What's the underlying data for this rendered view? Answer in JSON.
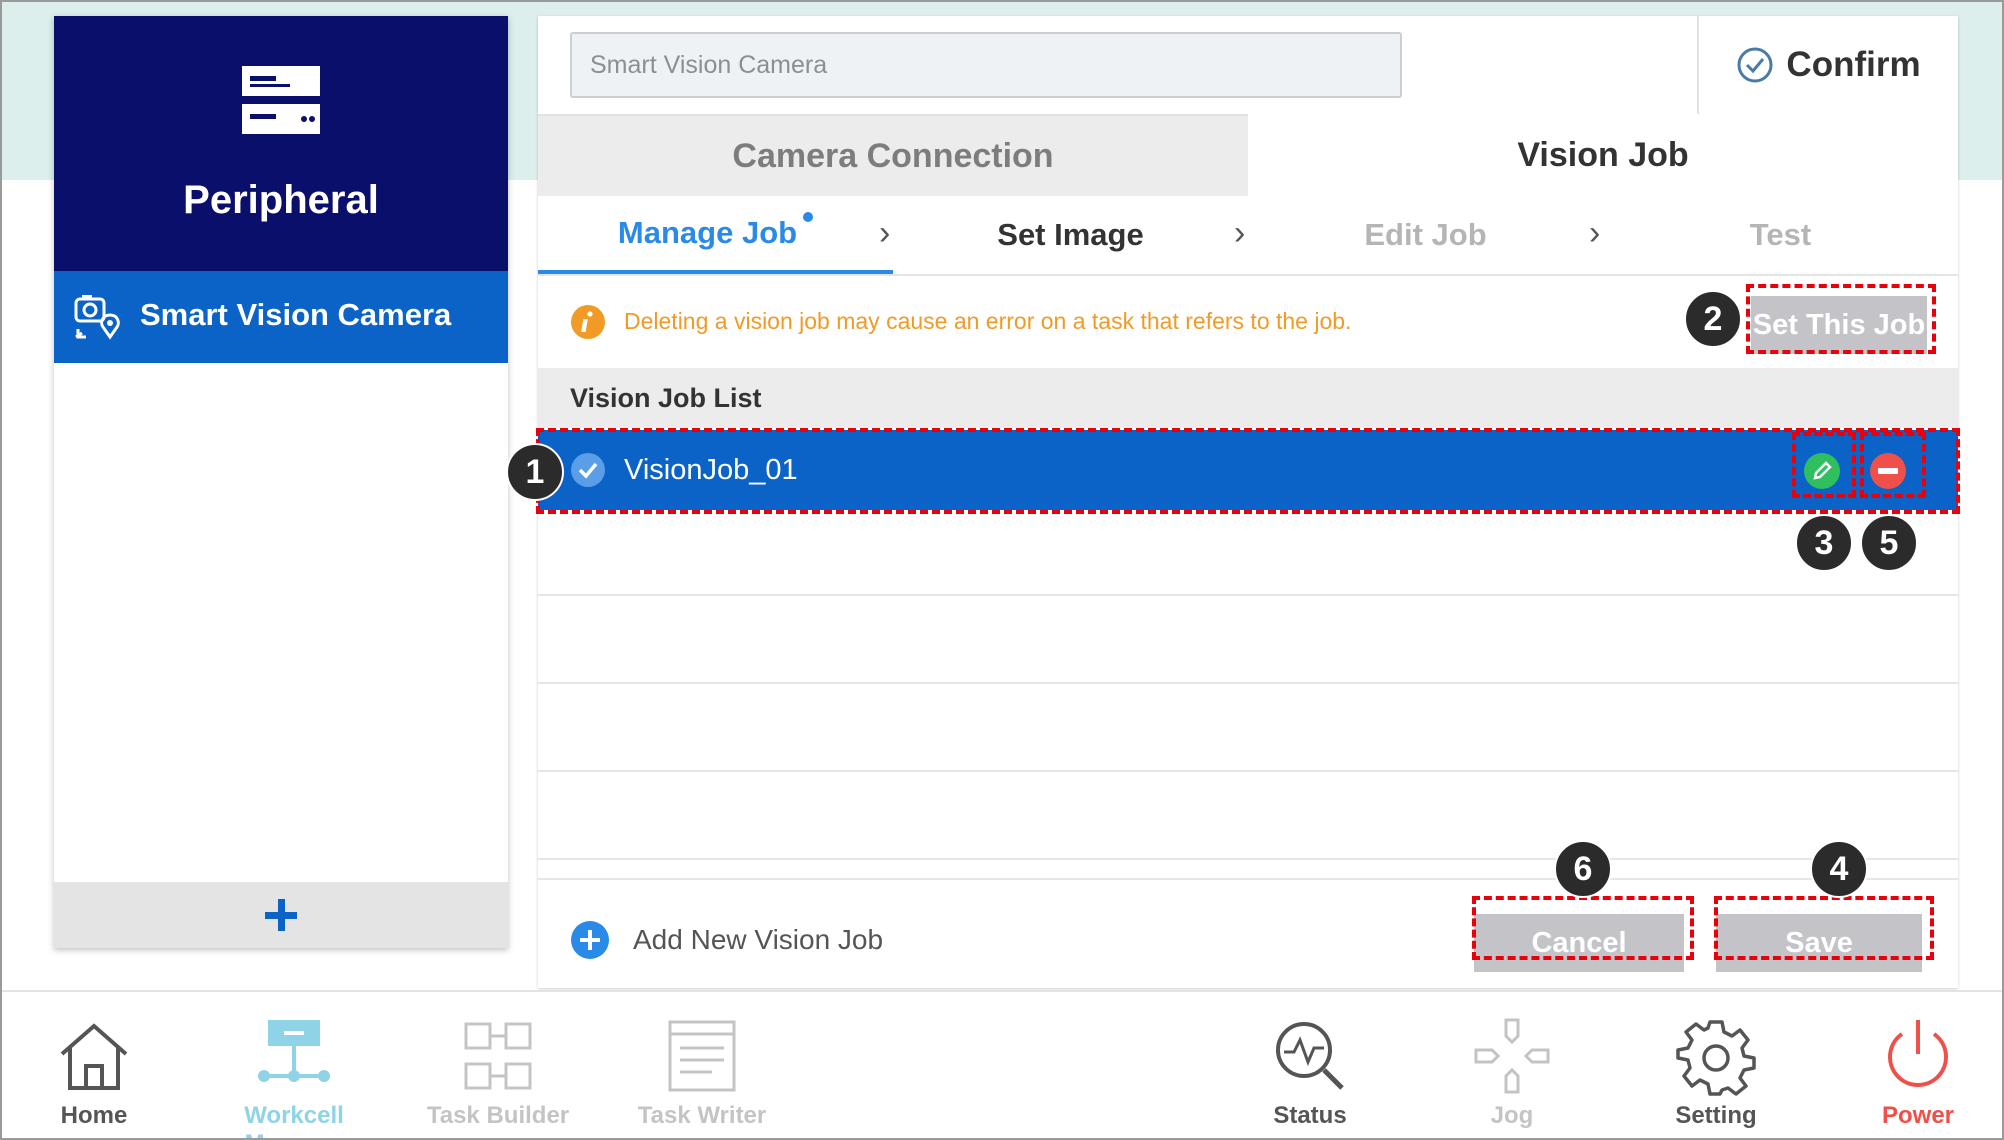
{
  "sidebar": {
    "title": "Peripheral",
    "items": [
      {
        "label": "Smart Vision Camera"
      }
    ],
    "add_symbol": "+"
  },
  "header": {
    "name_field": {
      "value": "Smart Vision Camera",
      "placeholder": "Smart Vision Camera"
    },
    "confirm_label": "Confirm"
  },
  "tabs": [
    {
      "label": "Camera Connection",
      "active": false
    },
    {
      "label": "Vision Job",
      "active": true
    }
  ],
  "steps": [
    {
      "label": "Manage Job",
      "active": true
    },
    {
      "label": "Set Image"
    },
    {
      "label": "Edit Job"
    },
    {
      "label": "Test"
    }
  ],
  "step_separator": "›",
  "warning": {
    "text": "Deleting a vision job may cause an error on a task that refers to the job.",
    "icon": "info-icon",
    "color": "#f29a26"
  },
  "set_job_label": "Set This Job",
  "list": {
    "header": "Vision Job List",
    "jobs": [
      {
        "name": "VisionJob_01",
        "selected": true
      }
    ]
  },
  "footer": {
    "add_label": "Add New Vision Job",
    "cancel_label": "Cancel",
    "save_label": "Save"
  },
  "callouts": [
    "1",
    "2",
    "3",
    "4",
    "5",
    "6"
  ],
  "nav": [
    {
      "label": "Home",
      "icon": "home-icon"
    },
    {
      "label": "Workcell Manager",
      "icon": "workcell-icon",
      "active": true
    },
    {
      "label": "Task Builder",
      "icon": "task-builder-icon"
    },
    {
      "label": "Task Writer",
      "icon": "task-writer-icon"
    },
    {
      "label": "Status",
      "icon": "status-icon"
    },
    {
      "label": "Jog",
      "icon": "jog-icon"
    },
    {
      "label": "Setting",
      "icon": "gear-icon"
    },
    {
      "label": "Power",
      "icon": "power-icon"
    }
  ],
  "colors": {
    "sidebar_header": "#0a0f6b",
    "selected_blue": "#0b62c7",
    "accent_blue": "#2a8ae8",
    "annotation_red": "#e8000b",
    "power_red": "#f0504a",
    "workcell_teal": "#8fd3e6"
  }
}
